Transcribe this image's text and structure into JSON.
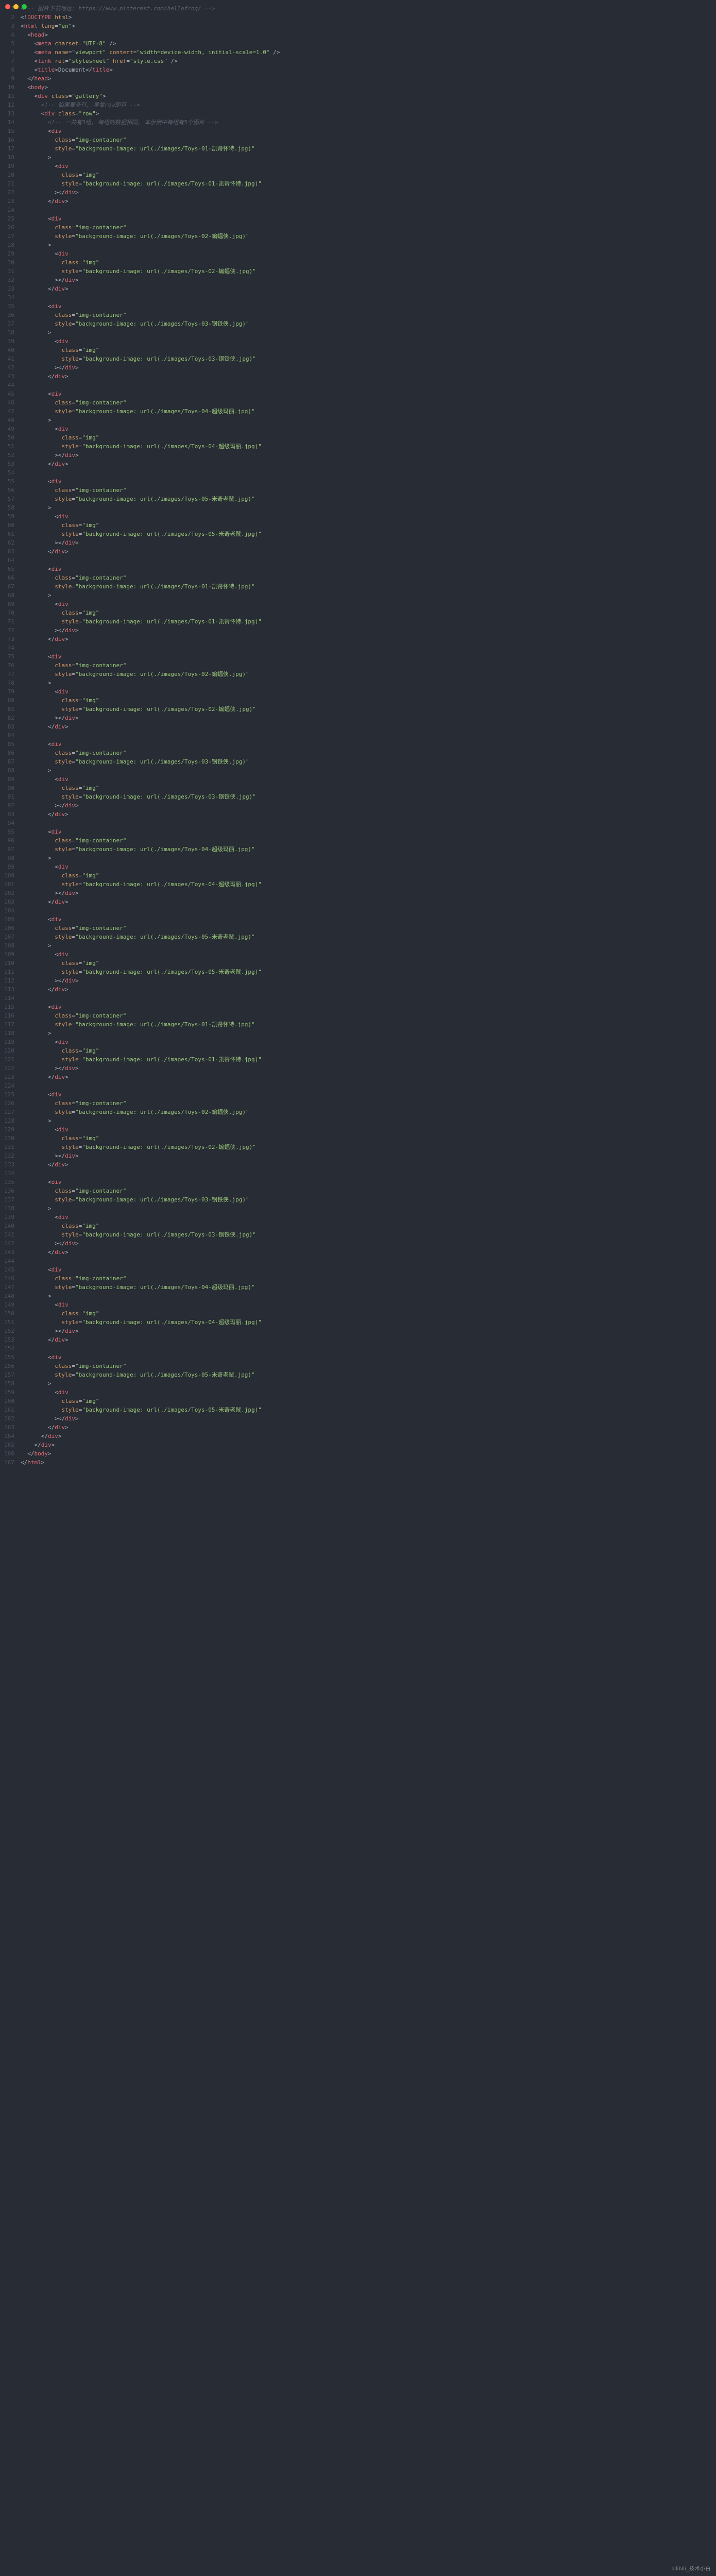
{
  "window": {
    "dots": [
      "red",
      "yellow",
      "green"
    ]
  },
  "watermark": "bilibili_技术小白",
  "lines": [
    {
      "n": 1,
      "indent": 0,
      "kind": "comment",
      "text": "<!-- 图片下载地址: https://www.pinterest.com/hellofrog/ -->"
    },
    {
      "n": 2,
      "indent": 0,
      "kind": "doctype",
      "text": "<!DOCTYPE html>"
    },
    {
      "n": 3,
      "indent": 0,
      "kind": "open",
      "tag": "html",
      "attrs": [
        [
          "lang",
          "en"
        ]
      ]
    },
    {
      "n": 4,
      "indent": 1,
      "kind": "open",
      "tag": "head"
    },
    {
      "n": 5,
      "indent": 2,
      "kind": "self",
      "tag": "meta",
      "attrs": [
        [
          "charset",
          "UTF-8"
        ]
      ]
    },
    {
      "n": 6,
      "indent": 2,
      "kind": "self",
      "tag": "meta",
      "attrs": [
        [
          "name",
          "viewport"
        ],
        [
          "content",
          "width=device-width, initial-scale=1.0"
        ]
      ]
    },
    {
      "n": 7,
      "indent": 2,
      "kind": "self",
      "tag": "link",
      "attrs": [
        [
          "rel",
          "stylesheet"
        ],
        [
          "href",
          "style.css"
        ]
      ]
    },
    {
      "n": 8,
      "indent": 2,
      "kind": "inline",
      "tag": "title",
      "inner": "Document"
    },
    {
      "n": 9,
      "indent": 1,
      "kind": "close",
      "tag": "head"
    },
    {
      "n": 10,
      "indent": 1,
      "kind": "open",
      "tag": "body"
    },
    {
      "n": 11,
      "indent": 2,
      "kind": "open",
      "tag": "div",
      "attrs": [
        [
          "class",
          "gallery"
        ]
      ]
    },
    {
      "n": 12,
      "indent": 3,
      "kind": "comment",
      "text": "<!-- 如果要多行, 重复row即可 -->"
    },
    {
      "n": 13,
      "indent": 3,
      "kind": "open",
      "tag": "div",
      "attrs": [
        [
          "class",
          "row"
        ]
      ]
    },
    {
      "n": 14,
      "indent": 4,
      "kind": "comment",
      "text": "<!-- 一共有3组, 每组的数据相同, 本示例中每组有5个图片 -->"
    },
    {
      "n": 15,
      "indent": 4,
      "kind": "openm",
      "tag": "div"
    },
    {
      "n": 16,
      "indent": 5,
      "kind": "attrline",
      "name": "class",
      "value": "img-container"
    },
    {
      "n": 17,
      "indent": 5,
      "kind": "attrline",
      "name": "style",
      "value": "background-image: url(./images/Toys-01-凯蒂怀特.jpg)"
    },
    {
      "n": 18,
      "indent": 4,
      "kind": "gt"
    },
    {
      "n": 19,
      "indent": 5,
      "kind": "openm",
      "tag": "div"
    },
    {
      "n": 20,
      "indent": 6,
      "kind": "attrline",
      "name": "class",
      "value": "img"
    },
    {
      "n": 21,
      "indent": 6,
      "kind": "attrline",
      "name": "style",
      "value": "background-image: url(./images/Toys-01-凯蒂怀特.jpg)"
    },
    {
      "n": 22,
      "indent": 5,
      "kind": "gtclose",
      "tag": "div"
    },
    {
      "n": 23,
      "indent": 4,
      "kind": "close",
      "tag": "div"
    },
    {
      "n": 24,
      "indent": 0,
      "kind": "blank"
    },
    {
      "n": 25,
      "indent": 4,
      "kind": "openm",
      "tag": "div"
    },
    {
      "n": 26,
      "indent": 5,
      "kind": "attrline",
      "name": "class",
      "value": "img-container"
    },
    {
      "n": 27,
      "indent": 5,
      "kind": "attrline",
      "name": "style",
      "value": "background-image: url(./images/Toys-02-蝙蝠侠.jpg)"
    },
    {
      "n": 28,
      "indent": 4,
      "kind": "gt"
    },
    {
      "n": 29,
      "indent": 5,
      "kind": "openm",
      "tag": "div"
    },
    {
      "n": 30,
      "indent": 6,
      "kind": "attrline",
      "name": "class",
      "value": "img"
    },
    {
      "n": 31,
      "indent": 6,
      "kind": "attrline",
      "name": "style",
      "value": "background-image: url(./images/Toys-02-蝙蝠侠.jpg)"
    },
    {
      "n": 32,
      "indent": 5,
      "kind": "gtclose",
      "tag": "div"
    },
    {
      "n": 33,
      "indent": 4,
      "kind": "close",
      "tag": "div"
    },
    {
      "n": 34,
      "indent": 0,
      "kind": "blank"
    },
    {
      "n": 35,
      "indent": 4,
      "kind": "openm",
      "tag": "div"
    },
    {
      "n": 36,
      "indent": 5,
      "kind": "attrline",
      "name": "class",
      "value": "img-container"
    },
    {
      "n": 37,
      "indent": 5,
      "kind": "attrline",
      "name": "style",
      "value": "background-image: url(./images/Toys-03-钢铁侠.jpg)"
    },
    {
      "n": 38,
      "indent": 4,
      "kind": "gt"
    },
    {
      "n": 39,
      "indent": 5,
      "kind": "openm",
      "tag": "div"
    },
    {
      "n": 40,
      "indent": 6,
      "kind": "attrline",
      "name": "class",
      "value": "img"
    },
    {
      "n": 41,
      "indent": 6,
      "kind": "attrline",
      "name": "style",
      "value": "background-image: url(./images/Toys-03-钢铁侠.jpg)"
    },
    {
      "n": 42,
      "indent": 5,
      "kind": "gtclose",
      "tag": "div"
    },
    {
      "n": 43,
      "indent": 4,
      "kind": "close",
      "tag": "div"
    },
    {
      "n": 44,
      "indent": 0,
      "kind": "blank"
    },
    {
      "n": 45,
      "indent": 4,
      "kind": "openm",
      "tag": "div"
    },
    {
      "n": 46,
      "indent": 5,
      "kind": "attrline",
      "name": "class",
      "value": "img-container"
    },
    {
      "n": 47,
      "indent": 5,
      "kind": "attrline",
      "name": "style",
      "value": "background-image: url(./images/Toys-04-超级玛丽.jpg)"
    },
    {
      "n": 48,
      "indent": 4,
      "kind": "gt"
    },
    {
      "n": 49,
      "indent": 5,
      "kind": "openm",
      "tag": "div"
    },
    {
      "n": 50,
      "indent": 6,
      "kind": "attrline",
      "name": "class",
      "value": "img"
    },
    {
      "n": 51,
      "indent": 6,
      "kind": "attrline",
      "name": "style",
      "value": "background-image: url(./images/Toys-04-超级玛丽.jpg)"
    },
    {
      "n": 52,
      "indent": 5,
      "kind": "gtclose",
      "tag": "div"
    },
    {
      "n": 53,
      "indent": 4,
      "kind": "close",
      "tag": "div"
    },
    {
      "n": 54,
      "indent": 0,
      "kind": "blank"
    },
    {
      "n": 55,
      "indent": 4,
      "kind": "openm",
      "tag": "div"
    },
    {
      "n": 56,
      "indent": 5,
      "kind": "attrline",
      "name": "class",
      "value": "img-container"
    },
    {
      "n": 57,
      "indent": 5,
      "kind": "attrline",
      "name": "style",
      "value": "background-image: url(./images/Toys-05-米奇老鼠.jpg)"
    },
    {
      "n": 58,
      "indent": 4,
      "kind": "gt"
    },
    {
      "n": 59,
      "indent": 5,
      "kind": "openm",
      "tag": "div"
    },
    {
      "n": 60,
      "indent": 6,
      "kind": "attrline",
      "name": "class",
      "value": "img"
    },
    {
      "n": 61,
      "indent": 6,
      "kind": "attrline",
      "name": "style",
      "value": "background-image: url(./images/Toys-05-米奇老鼠.jpg)"
    },
    {
      "n": 62,
      "indent": 5,
      "kind": "gtclose",
      "tag": "div"
    },
    {
      "n": 63,
      "indent": 4,
      "kind": "close",
      "tag": "div"
    },
    {
      "n": 64,
      "indent": 0,
      "kind": "blank"
    },
    {
      "n": 65,
      "indent": 4,
      "kind": "openm",
      "tag": "div"
    },
    {
      "n": 66,
      "indent": 5,
      "kind": "attrline",
      "name": "class",
      "value": "img-container"
    },
    {
      "n": 67,
      "indent": 5,
      "kind": "attrline",
      "name": "style",
      "value": "background-image: url(./images/Toys-01-凯蒂怀特.jpg)"
    },
    {
      "n": 68,
      "indent": 4,
      "kind": "gt"
    },
    {
      "n": 69,
      "indent": 5,
      "kind": "openm",
      "tag": "div"
    },
    {
      "n": 70,
      "indent": 6,
      "kind": "attrline",
      "name": "class",
      "value": "img"
    },
    {
      "n": 71,
      "indent": 6,
      "kind": "attrline",
      "name": "style",
      "value": "background-image: url(./images/Toys-01-凯蒂怀特.jpg)"
    },
    {
      "n": 72,
      "indent": 5,
      "kind": "gtclose",
      "tag": "div"
    },
    {
      "n": 73,
      "indent": 4,
      "kind": "close",
      "tag": "div"
    },
    {
      "n": 74,
      "indent": 0,
      "kind": "blank"
    },
    {
      "n": 75,
      "indent": 4,
      "kind": "openm",
      "tag": "div"
    },
    {
      "n": 76,
      "indent": 5,
      "kind": "attrline",
      "name": "class",
      "value": "img-container"
    },
    {
      "n": 77,
      "indent": 5,
      "kind": "attrline",
      "name": "style",
      "value": "background-image: url(./images/Toys-02-蝙蝠侠.jpg)"
    },
    {
      "n": 78,
      "indent": 4,
      "kind": "gt"
    },
    {
      "n": 79,
      "indent": 5,
      "kind": "openm",
      "tag": "div"
    },
    {
      "n": 80,
      "indent": 6,
      "kind": "attrline",
      "name": "class",
      "value": "img"
    },
    {
      "n": 81,
      "indent": 6,
      "kind": "attrline",
      "name": "style",
      "value": "background-image: url(./images/Toys-02-蝙蝠侠.jpg)"
    },
    {
      "n": 82,
      "indent": 5,
      "kind": "gtclose",
      "tag": "div"
    },
    {
      "n": 83,
      "indent": 4,
      "kind": "close",
      "tag": "div"
    },
    {
      "n": 84,
      "indent": 0,
      "kind": "blank"
    },
    {
      "n": 85,
      "indent": 4,
      "kind": "openm",
      "tag": "div"
    },
    {
      "n": 86,
      "indent": 5,
      "kind": "attrline",
      "name": "class",
      "value": "img-container"
    },
    {
      "n": 87,
      "indent": 5,
      "kind": "attrline",
      "name": "style",
      "value": "background-image: url(./images/Toys-03-钢铁侠.jpg)"
    },
    {
      "n": 88,
      "indent": 4,
      "kind": "gt"
    },
    {
      "n": 89,
      "indent": 5,
      "kind": "openm",
      "tag": "div"
    },
    {
      "n": 90,
      "indent": 6,
      "kind": "attrline",
      "name": "class",
      "value": "img"
    },
    {
      "n": 91,
      "indent": 6,
      "kind": "attrline",
      "name": "style",
      "value": "background-image: url(./images/Toys-03-钢铁侠.jpg)"
    },
    {
      "n": 92,
      "indent": 5,
      "kind": "gtclose",
      "tag": "div"
    },
    {
      "n": 93,
      "indent": 4,
      "kind": "close",
      "tag": "div"
    },
    {
      "n": 94,
      "indent": 0,
      "kind": "blank"
    },
    {
      "n": 95,
      "indent": 4,
      "kind": "openm",
      "tag": "div"
    },
    {
      "n": 96,
      "indent": 5,
      "kind": "attrline",
      "name": "class",
      "value": "img-container"
    },
    {
      "n": 97,
      "indent": 5,
      "kind": "attrline",
      "name": "style",
      "value": "background-image: url(./images/Toys-04-超级玛丽.jpg)"
    },
    {
      "n": 98,
      "indent": 4,
      "kind": "gt"
    },
    {
      "n": 99,
      "indent": 5,
      "kind": "openm",
      "tag": "div"
    },
    {
      "n": 100,
      "indent": 6,
      "kind": "attrline",
      "name": "class",
      "value": "img"
    },
    {
      "n": 101,
      "indent": 6,
      "kind": "attrline",
      "name": "style",
      "value": "background-image: url(./images/Toys-04-超级玛丽.jpg)"
    },
    {
      "n": 102,
      "indent": 5,
      "kind": "gtclose",
      "tag": "div"
    },
    {
      "n": 103,
      "indent": 4,
      "kind": "close",
      "tag": "div"
    },
    {
      "n": 104,
      "indent": 0,
      "kind": "blank"
    },
    {
      "n": 105,
      "indent": 4,
      "kind": "openm",
      "tag": "div"
    },
    {
      "n": 106,
      "indent": 5,
      "kind": "attrline",
      "name": "class",
      "value": "img-container"
    },
    {
      "n": 107,
      "indent": 5,
      "kind": "attrline",
      "name": "style",
      "value": "background-image: url(./images/Toys-05-米奇老鼠.jpg)"
    },
    {
      "n": 108,
      "indent": 4,
      "kind": "gt"
    },
    {
      "n": 109,
      "indent": 5,
      "kind": "openm",
      "tag": "div"
    },
    {
      "n": 110,
      "indent": 6,
      "kind": "attrline",
      "name": "class",
      "value": "img"
    },
    {
      "n": 111,
      "indent": 6,
      "kind": "attrline",
      "name": "style",
      "value": "background-image: url(./images/Toys-05-米奇老鼠.jpg)"
    },
    {
      "n": 112,
      "indent": 5,
      "kind": "gtclose",
      "tag": "div"
    },
    {
      "n": 113,
      "indent": 4,
      "kind": "close",
      "tag": "div"
    },
    {
      "n": 114,
      "indent": 0,
      "kind": "blank"
    },
    {
      "n": 115,
      "indent": 4,
      "kind": "openm",
      "tag": "div"
    },
    {
      "n": 116,
      "indent": 5,
      "kind": "attrline",
      "name": "class",
      "value": "img-container"
    },
    {
      "n": 117,
      "indent": 5,
      "kind": "attrline",
      "name": "style",
      "value": "background-image: url(./images/Toys-01-凯蒂怀特.jpg)"
    },
    {
      "n": 118,
      "indent": 4,
      "kind": "gt"
    },
    {
      "n": 119,
      "indent": 5,
      "kind": "openm",
      "tag": "div"
    },
    {
      "n": 120,
      "indent": 6,
      "kind": "attrline",
      "name": "class",
      "value": "img"
    },
    {
      "n": 121,
      "indent": 6,
      "kind": "attrline",
      "name": "style",
      "value": "background-image: url(./images/Toys-01-凯蒂怀特.jpg)"
    },
    {
      "n": 122,
      "indent": 5,
      "kind": "gtclose",
      "tag": "div"
    },
    {
      "n": 123,
      "indent": 4,
      "kind": "close",
      "tag": "div"
    },
    {
      "n": 124,
      "indent": 0,
      "kind": "blank"
    },
    {
      "n": 125,
      "indent": 4,
      "kind": "openm",
      "tag": "div"
    },
    {
      "n": 126,
      "indent": 5,
      "kind": "attrline",
      "name": "class",
      "value": "img-container"
    },
    {
      "n": 127,
      "indent": 5,
      "kind": "attrline",
      "name": "style",
      "value": "background-image: url(./images/Toys-02-蝙蝠侠.jpg)"
    },
    {
      "n": 128,
      "indent": 4,
      "kind": "gt"
    },
    {
      "n": 129,
      "indent": 5,
      "kind": "openm",
      "tag": "div"
    },
    {
      "n": 130,
      "indent": 6,
      "kind": "attrline",
      "name": "class",
      "value": "img"
    },
    {
      "n": 131,
      "indent": 6,
      "kind": "attrline",
      "name": "style",
      "value": "background-image: url(./images/Toys-02-蝙蝠侠.jpg)"
    },
    {
      "n": 132,
      "indent": 5,
      "kind": "gtclose",
      "tag": "div"
    },
    {
      "n": 133,
      "indent": 4,
      "kind": "close",
      "tag": "div"
    },
    {
      "n": 134,
      "indent": 0,
      "kind": "blank"
    },
    {
      "n": 135,
      "indent": 4,
      "kind": "openm",
      "tag": "div"
    },
    {
      "n": 136,
      "indent": 5,
      "kind": "attrline",
      "name": "class",
      "value": "img-container"
    },
    {
      "n": 137,
      "indent": 5,
      "kind": "attrline",
      "name": "style",
      "value": "background-image: url(./images/Toys-03-钢铁侠.jpg)"
    },
    {
      "n": 138,
      "indent": 4,
      "kind": "gt"
    },
    {
      "n": 139,
      "indent": 5,
      "kind": "openm",
      "tag": "div"
    },
    {
      "n": 140,
      "indent": 6,
      "kind": "attrline",
      "name": "class",
      "value": "img"
    },
    {
      "n": 141,
      "indent": 6,
      "kind": "attrline",
      "name": "style",
      "value": "background-image: url(./images/Toys-03-钢铁侠.jpg)"
    },
    {
      "n": 142,
      "indent": 5,
      "kind": "gtclose",
      "tag": "div"
    },
    {
      "n": 143,
      "indent": 4,
      "kind": "close",
      "tag": "div"
    },
    {
      "n": 144,
      "indent": 0,
      "kind": "blank"
    },
    {
      "n": 145,
      "indent": 4,
      "kind": "openm",
      "tag": "div"
    },
    {
      "n": 146,
      "indent": 5,
      "kind": "attrline",
      "name": "class",
      "value": "img-container"
    },
    {
      "n": 147,
      "indent": 5,
      "kind": "attrline",
      "name": "style",
      "value": "background-image: url(./images/Toys-04-超级玛丽.jpg)"
    },
    {
      "n": 148,
      "indent": 4,
      "kind": "gt"
    },
    {
      "n": 149,
      "indent": 5,
      "kind": "openm",
      "tag": "div"
    },
    {
      "n": 150,
      "indent": 6,
      "kind": "attrline",
      "name": "class",
      "value": "img"
    },
    {
      "n": 151,
      "indent": 6,
      "kind": "attrline",
      "name": "style",
      "value": "background-image: url(./images/Toys-04-超级玛丽.jpg)"
    },
    {
      "n": 152,
      "indent": 5,
      "kind": "gtclose",
      "tag": "div"
    },
    {
      "n": 153,
      "indent": 4,
      "kind": "close",
      "tag": "div"
    },
    {
      "n": 154,
      "indent": 0,
      "kind": "blank"
    },
    {
      "n": 155,
      "indent": 4,
      "kind": "openm",
      "tag": "div"
    },
    {
      "n": 156,
      "indent": 5,
      "kind": "attrline",
      "name": "class",
      "value": "img-container"
    },
    {
      "n": 157,
      "indent": 5,
      "kind": "attrline",
      "name": "style",
      "value": "background-image: url(./images/Toys-05-米奇老鼠.jpg)"
    },
    {
      "n": 158,
      "indent": 4,
      "kind": "gt"
    },
    {
      "n": 159,
      "indent": 5,
      "kind": "openm",
      "tag": "div"
    },
    {
      "n": 160,
      "indent": 6,
      "kind": "attrline",
      "name": "class",
      "value": "img"
    },
    {
      "n": 161,
      "indent": 6,
      "kind": "attrline",
      "name": "style",
      "value": "background-image: url(./images/Toys-05-米奇老鼠.jpg)"
    },
    {
      "n": 162,
      "indent": 5,
      "kind": "gtclose",
      "tag": "div"
    },
    {
      "n": 163,
      "indent": 4,
      "kind": "close",
      "tag": "div"
    },
    {
      "n": 164,
      "indent": 3,
      "kind": "close",
      "tag": "div"
    },
    {
      "n": 165,
      "indent": 2,
      "kind": "close",
      "tag": "div"
    },
    {
      "n": 166,
      "indent": 1,
      "kind": "close",
      "tag": "body"
    },
    {
      "n": 167,
      "indent": 0,
      "kind": "close",
      "tag": "html"
    }
  ]
}
